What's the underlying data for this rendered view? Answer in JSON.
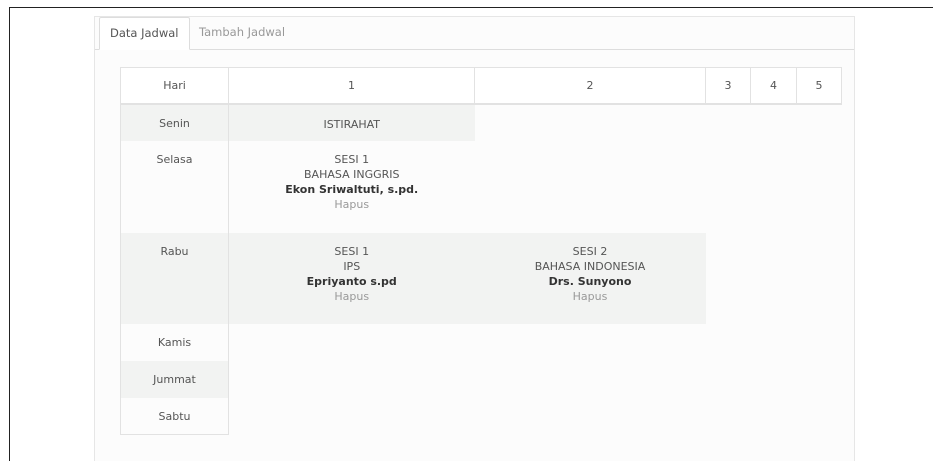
{
  "tabs": [
    {
      "label": "Data Jadwal",
      "active": true
    },
    {
      "label": "Tambah Jadwal",
      "active": false
    }
  ],
  "table": {
    "headers": [
      "Hari",
      "1",
      "2",
      "3",
      "4",
      "5"
    ],
    "rows": [
      {
        "day": "Senin",
        "slot1": {
          "text": "ISTIRAHAT"
        }
      },
      {
        "day": "Selasa",
        "slot1": {
          "sesi": "SESI 1",
          "subject": "BAHASA INGGRIS",
          "teacher": "Ekon Sriwaltuti, s.pd.",
          "action": "Hapus"
        }
      },
      {
        "day": "Rabu",
        "slot1": {
          "sesi": "SESI 1",
          "subject": "IPS",
          "teacher": "Epriyanto s.pd",
          "action": "Hapus"
        },
        "slot2": {
          "sesi": "SESI 2",
          "subject": "BAHASA INDONESIA",
          "teacher": "Drs. Sunyono",
          "action": "Hapus"
        }
      },
      {
        "day": "Kamis"
      },
      {
        "day": "Jummat"
      },
      {
        "day": "Sabtu"
      }
    ]
  }
}
